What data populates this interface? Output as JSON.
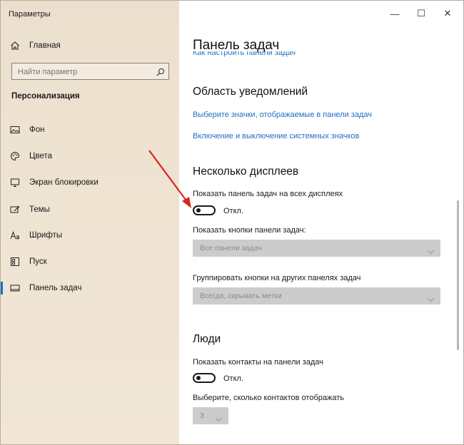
{
  "window": {
    "title": "Параметры",
    "minimize": "—",
    "maximize": "☐",
    "close": "✕"
  },
  "sidebar": {
    "home": "Главная",
    "search_placeholder": "Найти параметр",
    "section": "Персонализация",
    "items": [
      {
        "label": "Фон",
        "icon": "image-icon"
      },
      {
        "label": "Цвета",
        "icon": "palette-icon"
      },
      {
        "label": "Экран блокировки",
        "icon": "lock-screen-icon"
      },
      {
        "label": "Темы",
        "icon": "themes-icon"
      },
      {
        "label": "Шрифты",
        "icon": "fonts-icon"
      },
      {
        "label": "Пуск",
        "icon": "start-icon"
      },
      {
        "label": "Панель задач",
        "icon": "taskbar-icon",
        "selected": true
      }
    ]
  },
  "main": {
    "title": "Панель задач",
    "cut_link": "Как настроить панели задач",
    "notifications": {
      "heading": "Область уведомлений",
      "link1": "Выберите значки, отображаемые в панели задач",
      "link2": "Включение и выключение системных значков"
    },
    "multi": {
      "heading": "Несколько дисплеев",
      "show_all_label": "Показать панель задач на всех дисплеях",
      "toggle_state": "Откл.",
      "buttons_label": "Показать кнопки панели задач:",
      "buttons_value": "Все панели задач",
      "group_label": "Группировать кнопки на других панелях задач",
      "group_value": "Всегда, скрывать метки"
    },
    "people": {
      "heading": "Люди",
      "contacts_label": "Показать контакты на панели задач",
      "toggle_state": "Откл.",
      "count_label": "Выберите, сколько контактов отображать",
      "count_value": "3"
    }
  },
  "colors": {
    "accent": "#1f6ec4",
    "annotation_arrow": "#d9261c"
  }
}
